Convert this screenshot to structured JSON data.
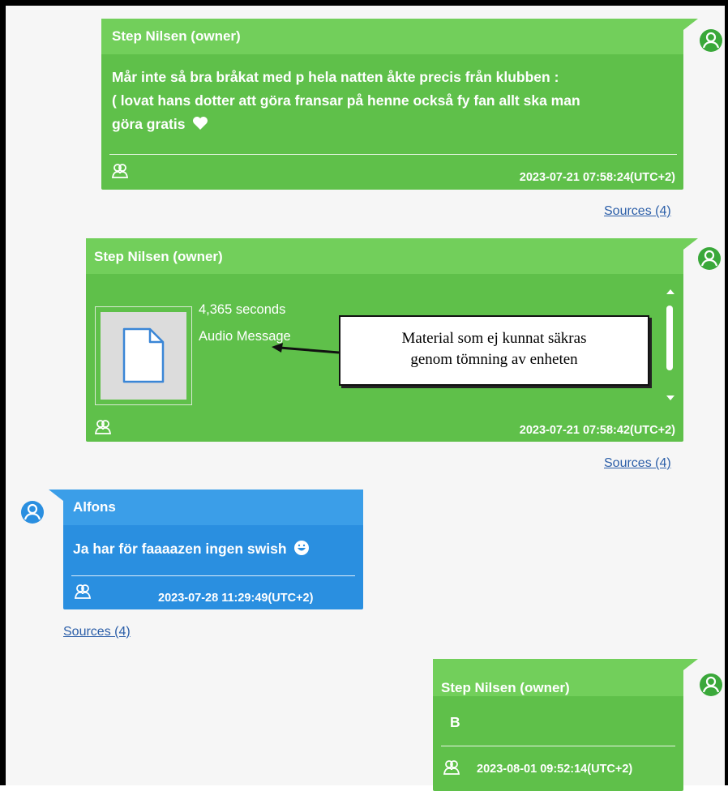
{
  "messages": [
    {
      "sender": "Step Nilsen (owner)",
      "text_lines": [
        "Mår inte så bra bråkat med p hela natten åkte precis från klubben :",
        "( lovat hans dotter att göra fransar på henne också fy fan allt ska man",
        "göra gratis"
      ],
      "timestamp": "2023-07-21 07:58:24(UTC+2)",
      "sources": "Sources (4)"
    },
    {
      "sender": "Step Nilsen (owner)",
      "duration": "4,365 seconds",
      "attachment_type": "Audio Message",
      "callout_lines": [
        "Material som ej kunnat säkras",
        "genom tömning av enheten"
      ],
      "timestamp": "2023-07-21 07:58:42(UTC+2)",
      "sources": "Sources (4)"
    },
    {
      "sender": "Alfons",
      "text": "Ja har för faaaazen ingen swish",
      "timestamp": "2023-07-28 11:29:49(UTC+2)",
      "sources": "Sources (4)"
    },
    {
      "sender": "Step Nilsen (owner)",
      "text": "B",
      "timestamp": "2023-08-01 09:52:14(UTC+2)"
    }
  ],
  "colors": {
    "outgoing_bubble": "#5fc04a",
    "outgoing_header": "#72cf5b",
    "incoming_bubble": "#2a8fe0",
    "link": "#2b5ea8",
    "avatar_green": "#3aa83a",
    "avatar_blue": "#2a8fe0"
  },
  "icons": [
    "user-avatar-icon",
    "group-icon",
    "heart-emoji-icon",
    "smile-emoji-icon",
    "document-icon",
    "arrow-icon"
  ]
}
